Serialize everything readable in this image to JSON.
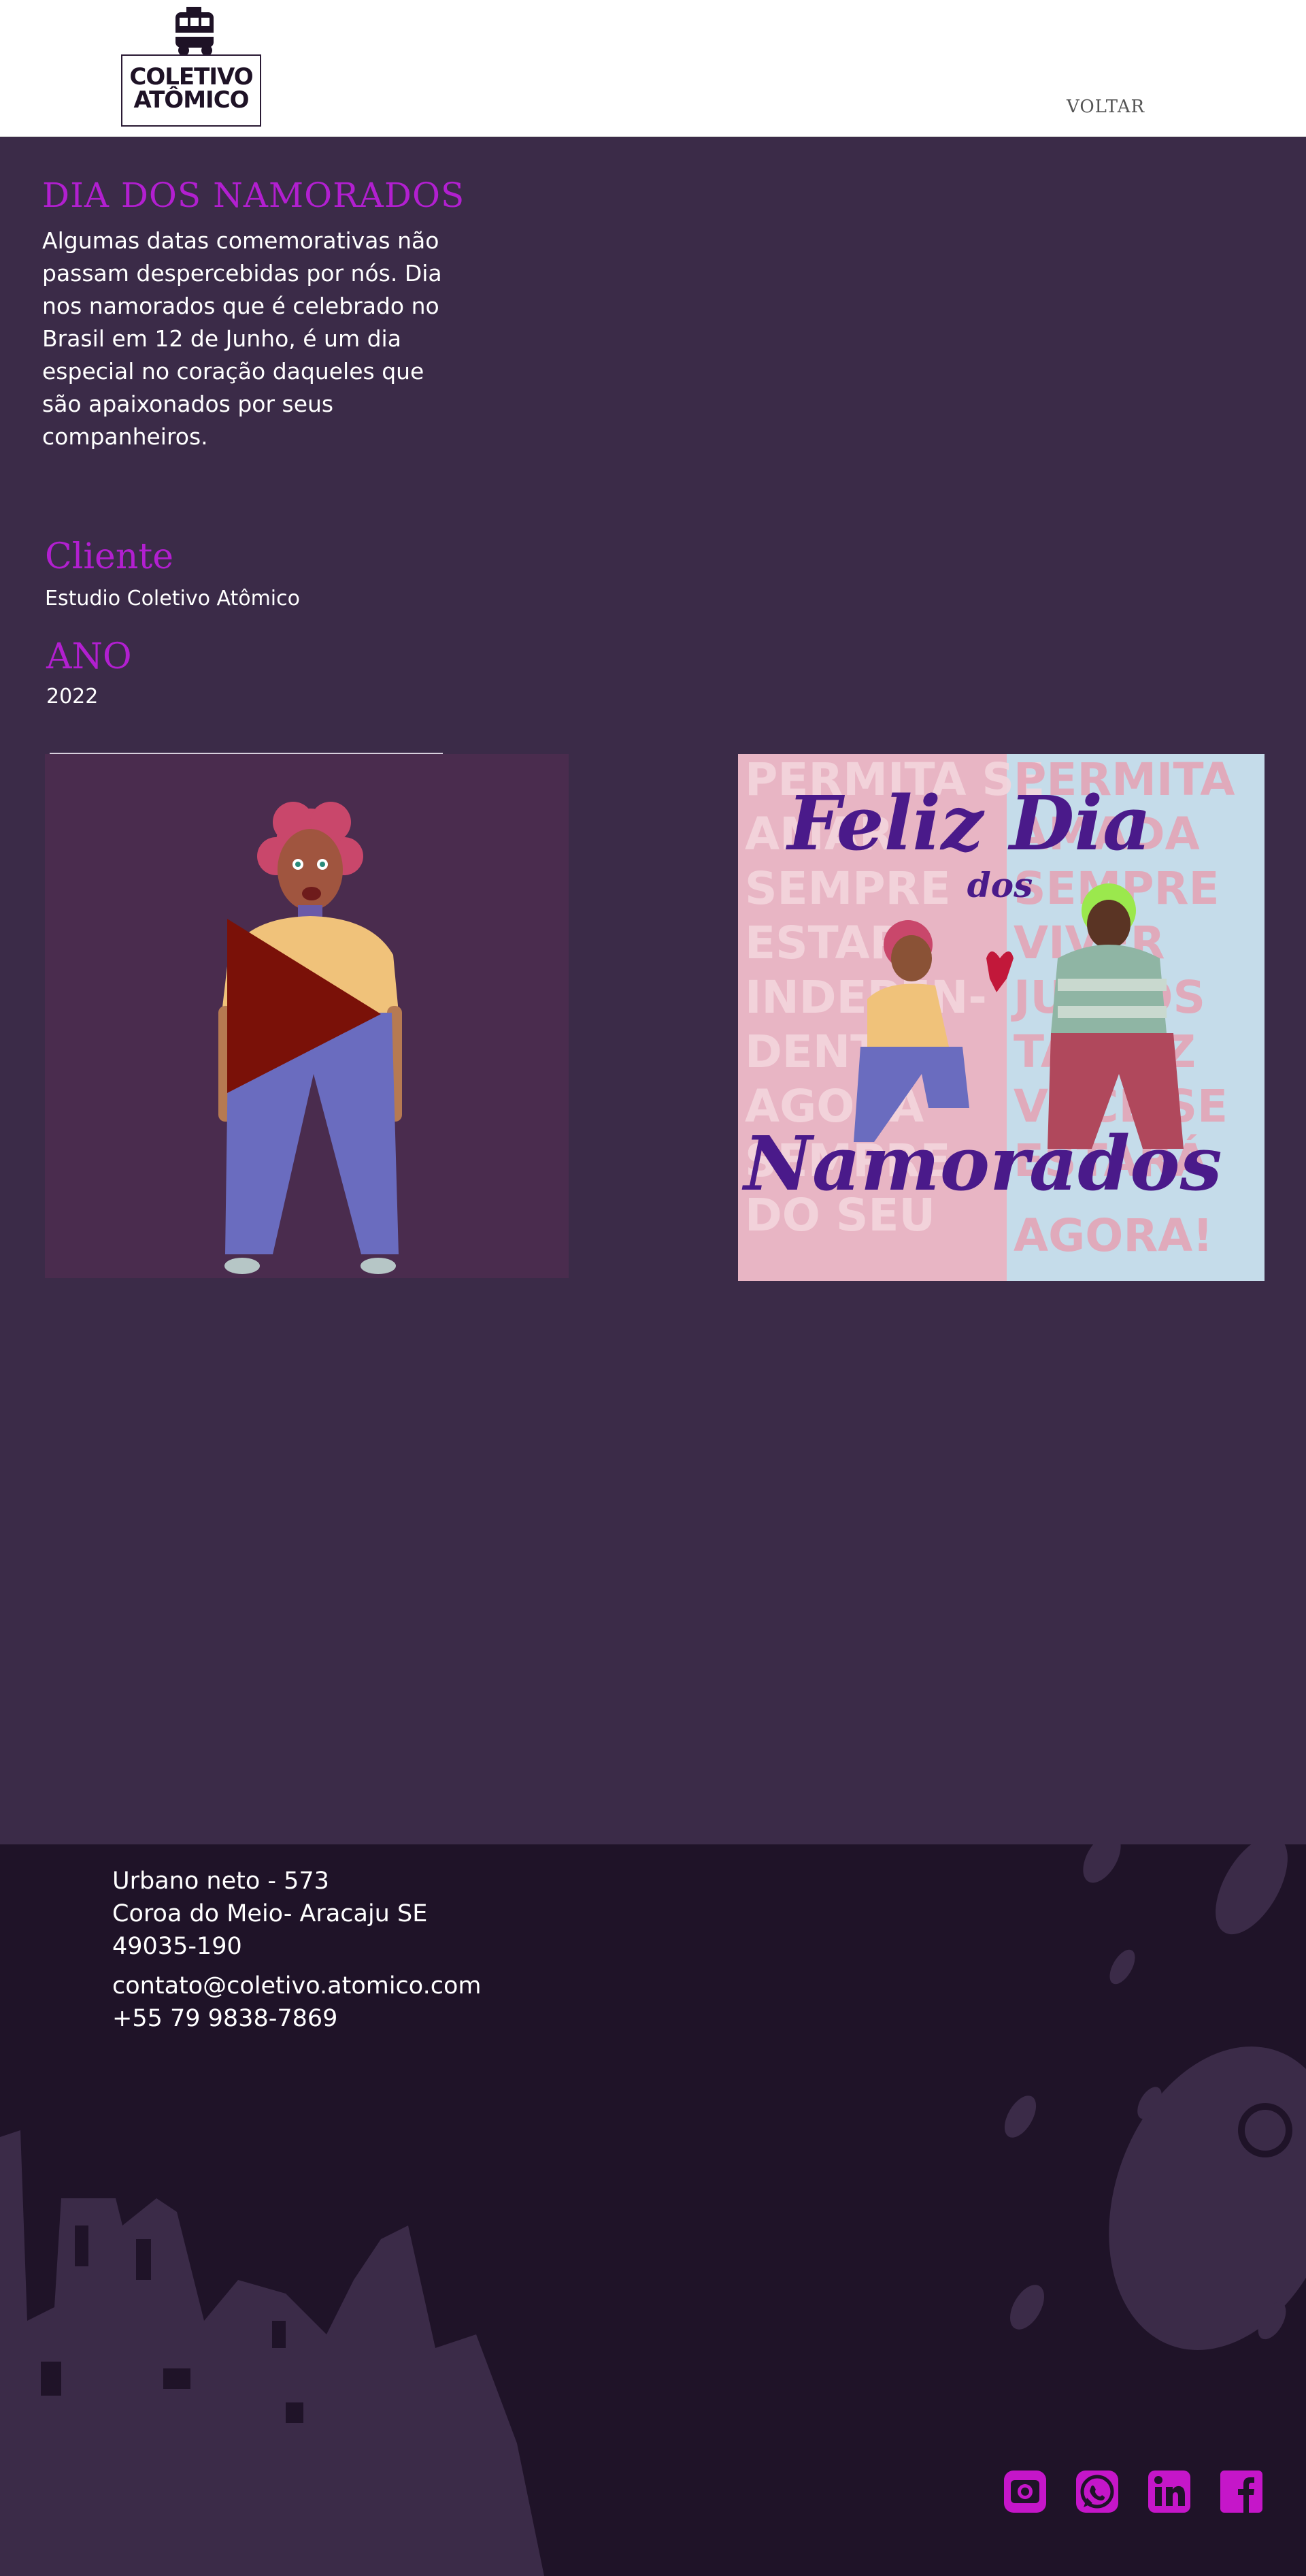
{
  "header": {
    "logo": {
      "line1": "COLETIVO",
      "line2": "ATÔMICO",
      "icon": "bus-logo-icon"
    },
    "back_link": "VOLTAR"
  },
  "project": {
    "title": "DIA DOS NAMORADOS",
    "description": "Algumas datas comemorativas não passam despercebidas por nós. Dia nos namorados que é celebrado no Brasil em 12 de Junho, é um dia especial no coração daqueles que são apaixonados por seus companheiros.",
    "client_label": "Cliente",
    "client_value": "Estudio Coletivo Atômico",
    "year_label": "ANO",
    "year_value": "2022"
  },
  "media": {
    "video_play_icon": "play-icon",
    "poster": {
      "title_line1": "Feliz Dia",
      "title_line2": "dos",
      "title_line3": "Namorados",
      "background_left": "PERMITA SE AMAR SEMPRE VIVER ESTAR INDEPEN-DENTE AGORA SEMPRE DO SEU LADO!!!",
      "background_right": "PERMITA SER AMADA POR SEMPRE VIVER JUNTOS TALVEZ A FELICIDADE VOCE SE ESTARA AGORA!",
      "colors": {
        "left_bg": "#e8b5c4",
        "right_bg": "#c5dcea",
        "title": "#4a1a8a"
      }
    }
  },
  "footer": {
    "address_line1": "Urbano neto - 573",
    "address_line2": "Coroa do Meio- Aracaju SE",
    "address_line3": "49035-190",
    "email": "contato@coletivo.atomico.com",
    "phone": "+55 79 9838-7869",
    "social": [
      "instagram-icon",
      "whatsapp-icon",
      "linkedin-icon",
      "facebook-icon"
    ],
    "accent": "#c516c9"
  },
  "colors": {
    "page_bg": "#3b2b48",
    "footer_bg": "#1f1328",
    "heading": "#b21fd0"
  }
}
